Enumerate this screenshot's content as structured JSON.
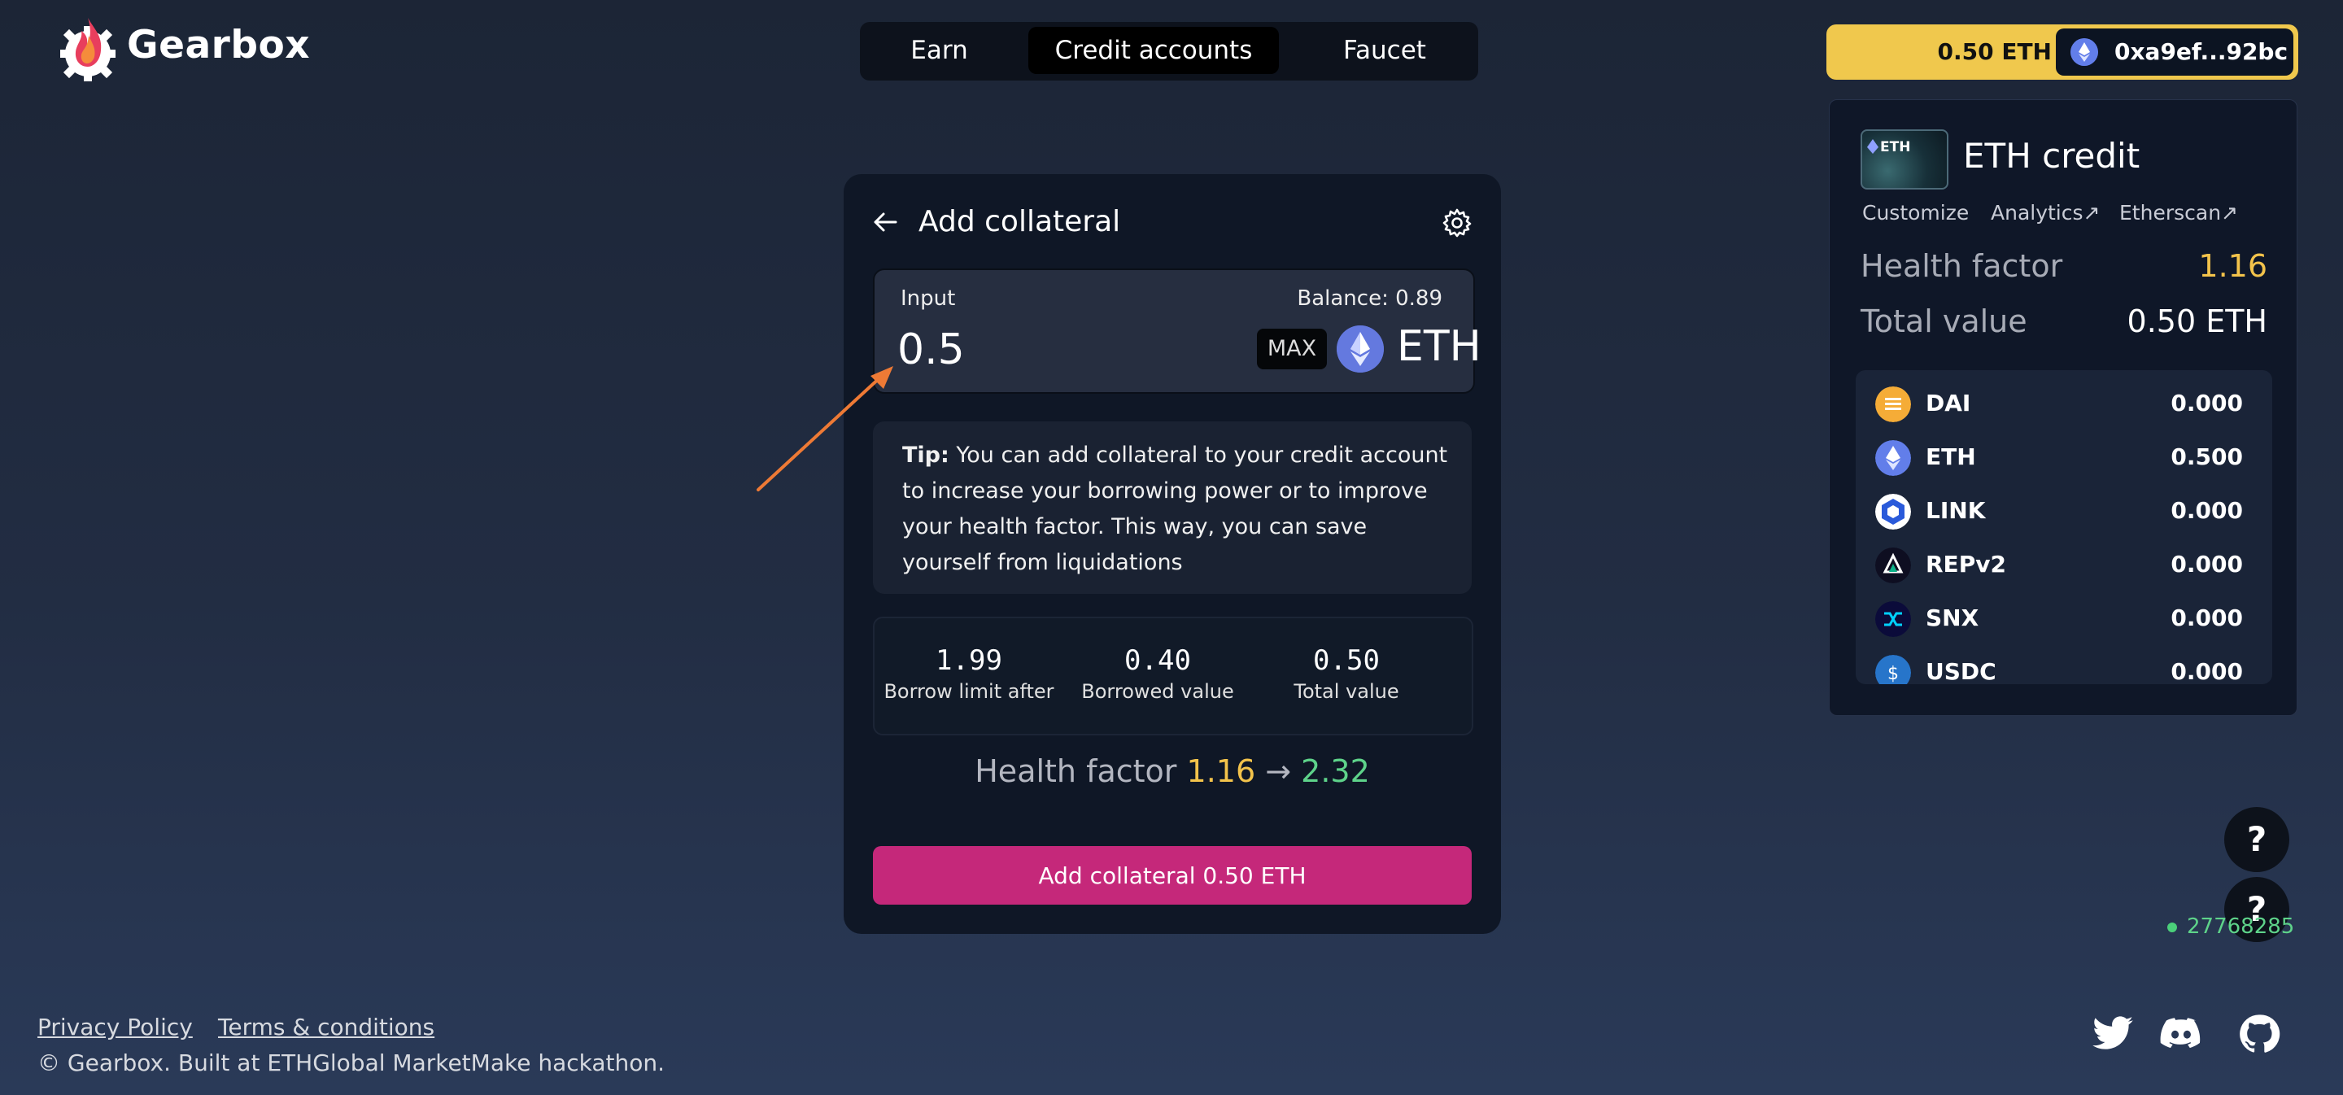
{
  "header": {
    "brand": "Gearbox",
    "nav": [
      "Earn",
      "Credit accounts",
      "Faucet"
    ],
    "active_nav": "Credit accounts",
    "wallet": {
      "balance": "0.50 ETH",
      "address": "0xa9ef...92bc"
    }
  },
  "account": {
    "thumb_label": "ETH",
    "title": "ETH credit",
    "links": [
      "Customize",
      "Analytics↗",
      "Etherscan↗"
    ],
    "health_factor_label": "Health factor",
    "health_factor_value": "1.16",
    "total_value_label": "Total value",
    "total_value_value": "0.50 ETH",
    "tokens": [
      {
        "name": "DAI",
        "amount": "0.000",
        "icon": "dai-icon",
        "color": "#f5ac37"
      },
      {
        "name": "ETH",
        "amount": "0.500",
        "icon": "eth-icon",
        "color": "#627eea"
      },
      {
        "name": "LINK",
        "amount": "0.000",
        "icon": "link-icon",
        "color": "#2a5ada"
      },
      {
        "name": "REPv2",
        "amount": "0.000",
        "icon": "rep-icon",
        "color": "#0e0e21"
      },
      {
        "name": "SNX",
        "amount": "0.000",
        "icon": "snx-icon",
        "color": "#0b0b3a"
      },
      {
        "name": "USDC",
        "amount": "0.000",
        "icon": "usdc-icon",
        "color": "#2775ca"
      }
    ]
  },
  "card": {
    "title": "Add collateral",
    "input_label": "Input",
    "balance": "Balance: 0.89",
    "amount": "0.5",
    "max_label": "MAX",
    "token": "ETH",
    "tip_bold": "Tip:",
    "tip_text": " You can add collateral to your credit account to increase your borrowing power or to improve your health factor. This way, you can save yourself from liquidations",
    "stats": [
      {
        "value": "1.99",
        "label": "Borrow limit after"
      },
      {
        "value": "0.40",
        "label": "Borrowed value"
      },
      {
        "value": "0.50",
        "label": "Total value"
      }
    ],
    "health_factor_label": "Health factor",
    "health_before": "1.16",
    "health_arrow": "→",
    "health_after": "2.32",
    "submit_label": "Add collateral 0.50 ETH"
  },
  "help_label": "?",
  "block_number": "27768285",
  "footer": {
    "privacy": "Privacy Policy",
    "terms": "Terms & conditions",
    "copyright": "© Gearbox. Built at ETHGlobal MarketMake hackathon."
  },
  "colors": {
    "accent": "#c5287a",
    "gold": "#f0c84d",
    "warning": "#f3c34b",
    "success": "#5ed38a"
  }
}
